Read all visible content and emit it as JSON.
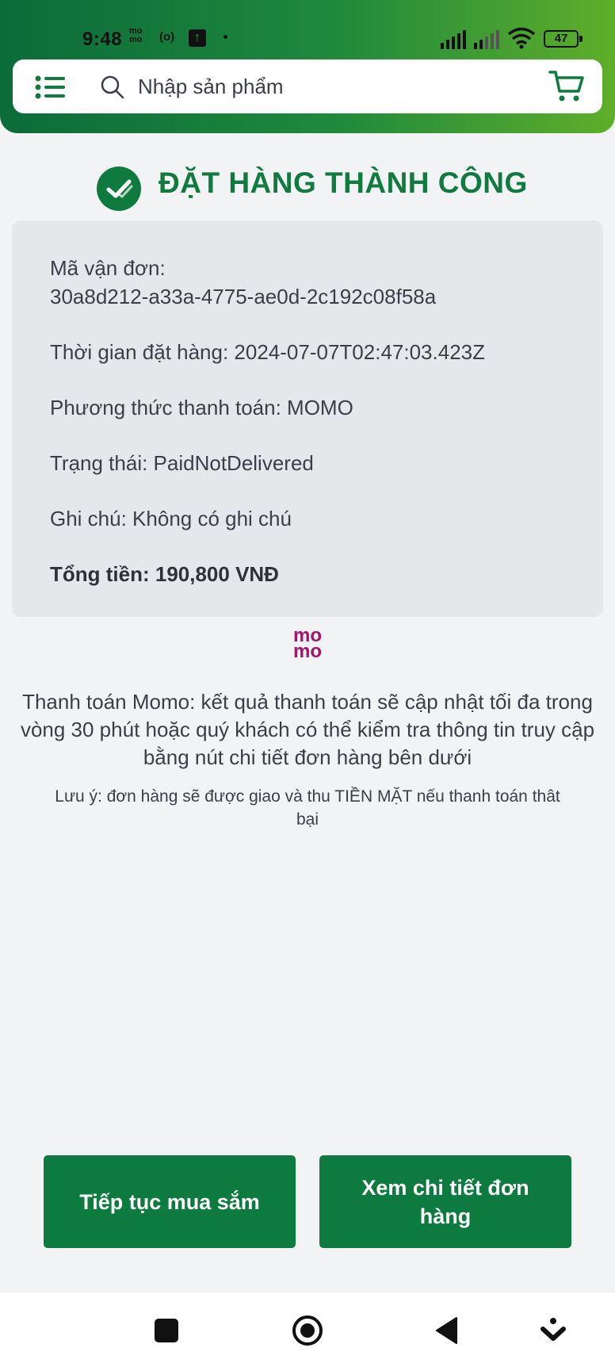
{
  "status_bar": {
    "time": "9:48",
    "momo_badge_top": "mo",
    "momo_badge_bottom": "mo",
    "radio_indicator": "(o)",
    "battery": "47"
  },
  "header": {
    "search_placeholder": "Nhập sản phẩm",
    "brand_gradient": [
      "#0b6b3a",
      "#5fae2a"
    ]
  },
  "order": {
    "success_title": "ĐẶT HÀNG THÀNH CÔNG",
    "tracking_label": "Mã vận đơn:",
    "tracking_value": "30a8d212-a33a-4775-ae0d-2c192c08f58a",
    "order_time": "Thời gian đặt hàng: 2024-07-07T02:47:03.423Z",
    "payment_method": "Phương thức thanh toán: MOMO",
    "status": "Trạng thái: PaidNotDelivered",
    "note": "Ghi chú: Không có ghi chú",
    "total": "Tổng tiền: 190,800 VNĐ"
  },
  "momo": {
    "logo_top": "mo",
    "logo_bottom": "mo",
    "brand_color": "#a4126b",
    "payment_note": "Thanh toán Momo: kết quả thanh toán sẽ cập nhật tối đa trong vòng 30 phút hoặc quý khách có thể kiểm tra thông tin truy cập bằng nút chi tiết đơn hàng bên dưới",
    "cod_note": "Lưu ý: đơn hàng sẽ được giao và thu TIỀN MẶT nếu thanh toán thât bại"
  },
  "actions": {
    "continue_label": "Tiếp tục mua sắm",
    "detail_label": "Xem chi tiết đơn hàng",
    "button_color": "#0d7a3f"
  },
  "icons": [
    "menu-icon",
    "search-icon",
    "cart-icon",
    "check-circle-icon",
    "momo-logo",
    "nav-recents-icon",
    "nav-home-icon",
    "nav-back-icon",
    "nav-down-icon"
  ]
}
